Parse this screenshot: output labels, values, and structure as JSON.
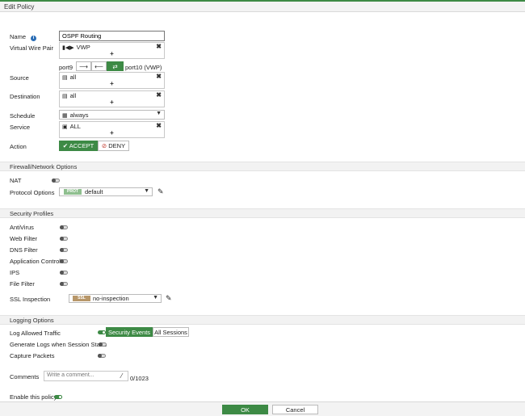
{
  "title": "Edit Policy",
  "name": {
    "label": "Name",
    "value": "OSPF Routing"
  },
  "vwp": {
    "label": "Virtual Wire Pair",
    "entry": "VWP",
    "port_left": "port9",
    "port_right": "port10 (VWP)"
  },
  "source": {
    "label": "Source",
    "entry": "all"
  },
  "destination": {
    "label": "Destination",
    "entry": "all"
  },
  "schedule": {
    "label": "Schedule",
    "value": "always"
  },
  "service": {
    "label": "Service",
    "entry": "ALL"
  },
  "action": {
    "label": "Action",
    "accept": "ACCEPT",
    "deny": "DENY"
  },
  "firewall": {
    "header": "Firewall/Network Options",
    "nat": "NAT",
    "protocol_label": "Protocol Options",
    "protocol_badge": "PROT",
    "protocol_value": "default"
  },
  "security": {
    "header": "Security Profiles",
    "items": [
      "AntiVirus",
      "Web Filter",
      "DNS Filter",
      "Application Control",
      "IPS",
      "File Filter"
    ],
    "ssl_label": "SSL Inspection",
    "ssl_badge": "SSL",
    "ssl_value": "no-inspection"
  },
  "logging": {
    "header": "Logging Options",
    "allowed": "Log Allowed Traffic",
    "security_events": "Security Events",
    "all_sessions": "All Sessions",
    "session_start": "Generate Logs when Session Starts",
    "capture": "Capture Packets"
  },
  "comments": {
    "label": "Comments",
    "placeholder": "Write a comment...",
    "counter": "0/1023"
  },
  "enable": "Enable this policy",
  "footer": {
    "ok": "OK",
    "cancel": "Cancel"
  },
  "colors": {
    "accent": "#3d8a45",
    "badge_proto": "#8fbf8f",
    "badge_ssl": "#b8976a"
  }
}
